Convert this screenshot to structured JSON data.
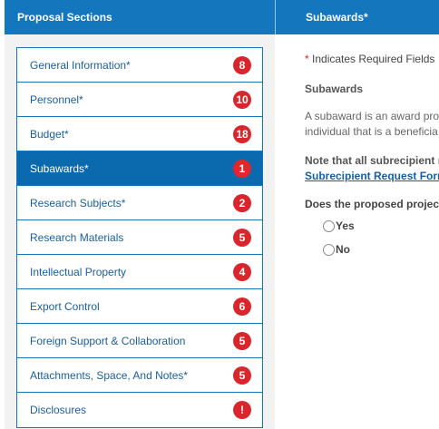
{
  "left_panel": {
    "title": "Proposal Sections",
    "sections": [
      {
        "label": "General Information*",
        "count": "8",
        "active": false
      },
      {
        "label": "Personnel*",
        "count": "10",
        "active": false
      },
      {
        "label": "Budget*",
        "count": "18",
        "active": false
      },
      {
        "label": "Subawards*",
        "count": "1",
        "active": true
      },
      {
        "label": "Research Subjects*",
        "count": "2",
        "active": false
      },
      {
        "label": "Research Materials",
        "count": "5",
        "active": false
      },
      {
        "label": "Intellectual Property",
        "count": "4",
        "active": false
      },
      {
        "label": "Export Control",
        "count": "6",
        "active": false
      },
      {
        "label": "Foreign Support & Collaboration",
        "count": "5",
        "active": false
      },
      {
        "label": "Attachments, Space, And Notes*",
        "count": "5",
        "active": false
      },
      {
        "label": "Disclosures",
        "count": "!",
        "active": false
      }
    ]
  },
  "right_panel": {
    "title": "Subawards*",
    "required_star": "*",
    "required_text": " Indicates Required Fields",
    "subheading": "Subawards",
    "para_line1": "A subaward is an award pro",
    "para_line2": "individual that is a beneficia",
    "note_line1": "Note that all subrecipient r",
    "note_link": "Subrecipient Request Form",
    "question": "Does the proposed project",
    "options": [
      "Yes",
      "No"
    ]
  },
  "colors": {
    "header_blue": "#1476bd",
    "active_blue": "#0b6aad",
    "badge_red": "#d9262c",
    "link_blue": "#1a5f9c"
  }
}
